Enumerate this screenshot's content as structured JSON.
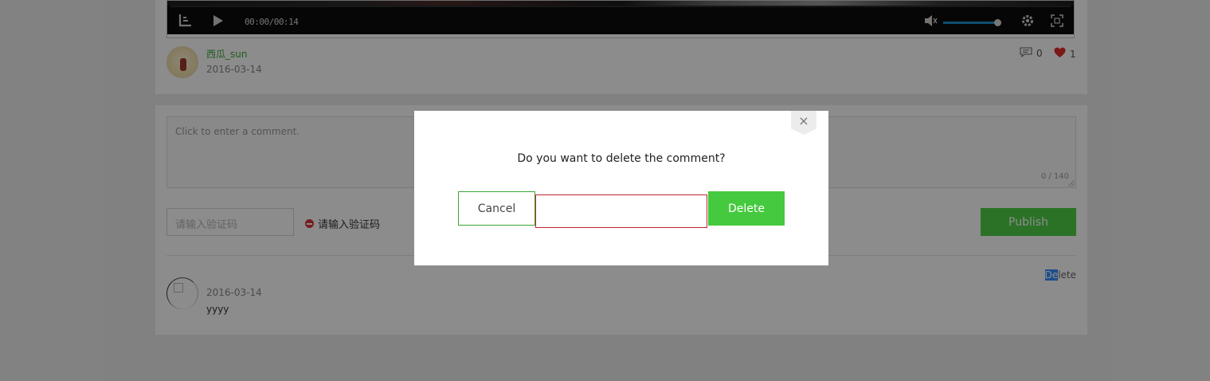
{
  "video": {
    "time": "00:00/00:14",
    "volume_level": 0.95
  },
  "post": {
    "author_name": "西瓜_sun",
    "date": "2016-03-14",
    "comment_count": "0",
    "like_count": "1"
  },
  "comment_form": {
    "placeholder": "Click to enter a comment.",
    "char_count": "0 / 140",
    "captcha_placeholder": "请输入验证码",
    "captcha_error": "请输入验证码",
    "publish_label": "Publish"
  },
  "comments": [
    {
      "date": "2016-03-14",
      "text": "yyyy",
      "delete_highlight": "De",
      "delete_rest": "lete"
    }
  ],
  "modal": {
    "close_glyph": "×",
    "message": "Do you want to delete the comment?",
    "cancel_label": "Cancel",
    "delete_label": "Delete"
  },
  "icons": {
    "logo": "logo-icon",
    "play": "play-icon",
    "volume": "volume-icon",
    "settings": "gear-icon",
    "fullscreen": "fullscreen-icon",
    "comment": "comment-icon",
    "like": "heart-icon",
    "error": "error-icon",
    "close": "close-icon"
  },
  "colors": {
    "accent_green": "#45c93e",
    "author_green": "#3aa935",
    "error_red": "#d9363e",
    "volume_blue": "#1f8ecf",
    "like_red": "#e02a2a"
  }
}
